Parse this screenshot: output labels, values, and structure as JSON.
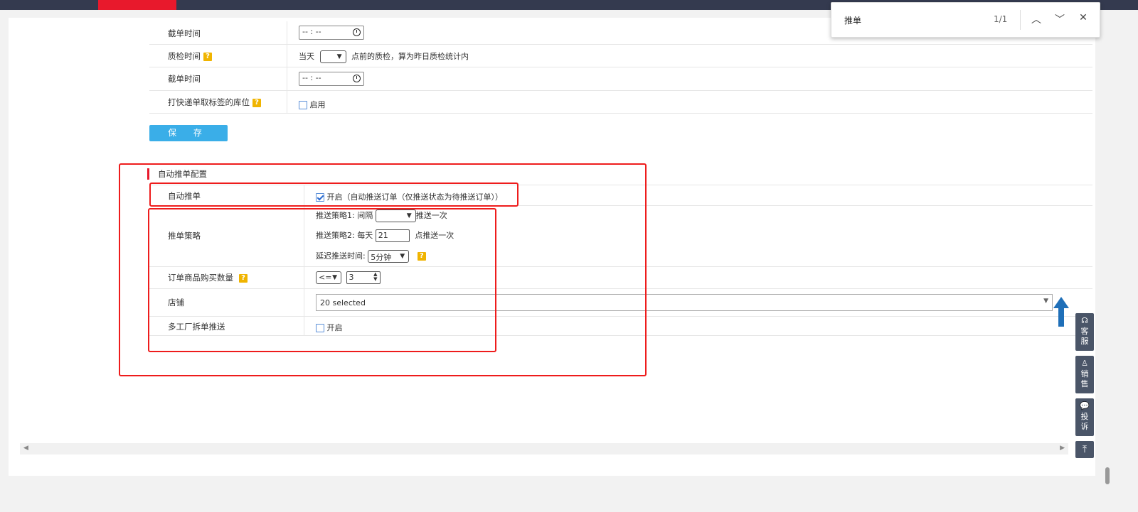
{
  "find_bar": {
    "query": "推单",
    "count": "1/1"
  },
  "rows_top": [
    {
      "label": "截单时间",
      "time": "-- : --"
    },
    {
      "label": "质检时间",
      "prefix": "当天",
      "suffix": "点前的质检，算为昨日质检统计内"
    },
    {
      "label": "截单时间",
      "time": "-- : --"
    },
    {
      "label": "打快递单取标签的库位",
      "checkbox_label": "启用"
    }
  ],
  "save_label": "保    存",
  "section_title": "自动推单配置",
  "auto_push": {
    "label": "自动推单",
    "checkbox_label": "开启（自动推送订单（仅推送状态为待推送订单））",
    "checked": true
  },
  "strategy": {
    "label": "推单策略",
    "s1_prefix": "推送策略1:",
    "s1_interval": "间隔",
    "s1_suffix": "推送一次",
    "s2_prefix": "推送策略2:",
    "s2_daily": "每天",
    "s2_value": "21",
    "s2_suffix": "点推送一次",
    "delay_label": "延迟推送时间:",
    "delay_value": "5分钟"
  },
  "quantity": {
    "label": "订单商品购买数量",
    "op": "<=",
    "value": "3"
  },
  "shop": {
    "label": "店铺",
    "value": "20 selected"
  },
  "multi_factory": {
    "label": "多工厂拆单推送",
    "checkbox_label": "开启"
  },
  "side_buttons": [
    {
      "l1": "客",
      "l2": "服"
    },
    {
      "l1": "销",
      "l2": "售"
    },
    {
      "l1": "投",
      "l2": "诉"
    }
  ],
  "colors": {
    "accent_red": "#e8192c",
    "save_blue": "#3aaee8",
    "highlight_box": "#ee1c1c"
  }
}
